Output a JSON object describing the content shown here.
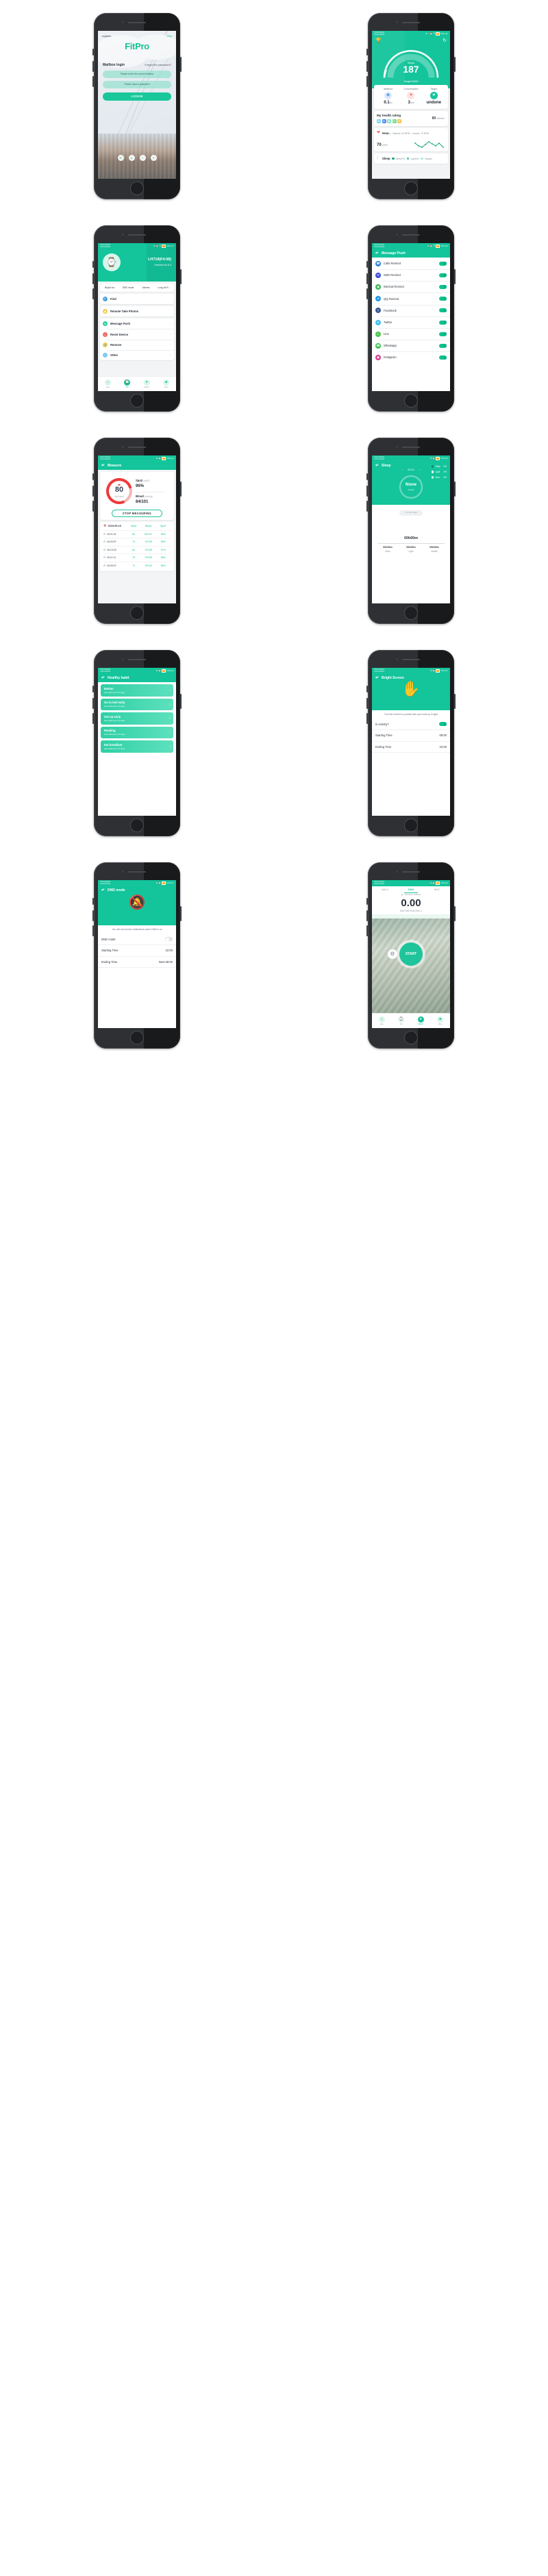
{
  "brand": "FitPro",
  "colors": {
    "primary": "#14c49b",
    "accent": "#19c79a",
    "heart": "#ef4b4b"
  },
  "statusbar": {
    "carrier1": "China Mobile",
    "carrier2": "China Mobile",
    "battery": "22",
    "time_dashboard": "5:01 pm",
    "time_device": "3:52 pm",
    "time_measure": "4:08 pm",
    "time_sleep": "4:18 pm",
    "time_habit": "4:18 pm",
    "time_bright": "4:18 pm",
    "time_dnd": "4:18 pm",
    "time_sport": "4:18 pm"
  },
  "login": {
    "register": "register",
    "skip": "Skip",
    "mailbox_login": "Mailbox login",
    "forget": "Forget the password?",
    "email_placeholder": "Please enter the correct mailbox",
    "password_placeholder": "Please input a password",
    "login_button": "LOGIN",
    "social_icons": [
      "wechat-icon",
      "qq-icon",
      "facebook-icon",
      "twitter-icon"
    ]
  },
  "dashboard": {
    "trophy_icon": "trophy-icon",
    "sync_icon": "sync-icon",
    "steps_label": "Steps",
    "steps_value": "187",
    "target_text": "Target:5000",
    "steps_percent": 4,
    "stats": [
      {
        "label": "distance",
        "value": "0.1",
        "unit": "km",
        "icon": "location-icon",
        "color": "#4a90e2"
      },
      {
        "label": "Consumption",
        "value": "3",
        "unit": "kcal",
        "icon": "flame-icon",
        "color": "#f2635f"
      },
      {
        "label": "Target",
        "value": "undone",
        "unit": "",
        "icon": "star-icon",
        "color": "#17c49b"
      }
    ],
    "health_rating_title": "My health rating",
    "grades": [
      {
        "letter": "S",
        "color": "#7fd8f0"
      },
      {
        "letter": "A",
        "color": "#5a8de8"
      },
      {
        "letter": "B",
        "color": "#8fe3bf"
      },
      {
        "letter": "C",
        "color": "#7bdd93"
      },
      {
        "letter": "F",
        "color": "#f7c45a"
      }
    ],
    "rating_value": "89",
    "rating_unit": "Minute",
    "heart_title": "Hear..",
    "heart_highest": "Highest: 84 BPM",
    "heart_lowest": "Lowest: 70 BPM",
    "heart_value": "70",
    "heart_unit": "BPM",
    "heart_series": [
      8,
      13,
      6,
      12,
      15,
      9,
      13,
      10,
      4
    ],
    "sleep_title": "Sleep",
    "sleep_legend": [
      {
        "label": "Deep0%",
        "color": "#0fa688"
      },
      {
        "label": "Light0%",
        "color": "#2fc9a5"
      },
      {
        "label": "Awake..",
        "color": "#9ef0d8"
      }
    ]
  },
  "device": {
    "name": "LH719(F4:08)",
    "version": "Version:V4.6.3",
    "watch_icon": "watch-icon",
    "quad": [
      "Bright scr..",
      "DND mode",
      "Alarms",
      "Long sit R.."
    ],
    "items": [
      {
        "label": "Find",
        "icon": "search-icon",
        "color": "#4aa8e8",
        "chev": false
      },
      {
        "label": "Remote Take Photos",
        "icon": "camera-icon",
        "color": "#f2cd4a",
        "chev": false
      },
      {
        "label": "Message Push",
        "icon": "send-icon",
        "color": "#2ecfa4",
        "chev": true
      },
      {
        "label": "Reset Device",
        "icon": "undo-icon",
        "color": "#f2706b",
        "chev": true
      },
      {
        "label": "Remove",
        "icon": "link-icon",
        "color": "#f2cd4a",
        "chev": true
      },
      {
        "label": "Other",
        "icon": "more-icon",
        "color": "#7ec8f0",
        "chev": true
      }
    ]
  },
  "tabbar": {
    "items": [
      {
        "label": "step",
        "icon": "home-icon"
      },
      {
        "label": "Set",
        "icon": "watch-icon"
      },
      {
        "label": "Motion",
        "icon": "run-icon"
      },
      {
        "label": "Mine",
        "icon": "user-icon"
      }
    ],
    "active_index": 1,
    "sport_active_index": 2
  },
  "message_push": {
    "title": "Message Push",
    "back_icon": "back-icon",
    "items": [
      {
        "label": "Calls Remind",
        "icon": "phone-icon",
        "color": "#2b7fd4",
        "on": true
      },
      {
        "label": "SMS Remind",
        "icon": "envelope-icon",
        "color": "#3b4fd8",
        "on": true
      },
      {
        "label": "Wechat Remind",
        "icon": "wechat-icon",
        "color": "#41b858",
        "on": true
      },
      {
        "label": "QQ Remind",
        "icon": "qq-icon",
        "color": "#1f9ae8",
        "on": true
      },
      {
        "label": "FaceBook",
        "icon": "facebook-icon",
        "color": "#3b5998",
        "on": true
      },
      {
        "label": "Twitter",
        "icon": "twitter-icon",
        "color": "#40c4f5",
        "on": true
      },
      {
        "label": "Line",
        "icon": "line-icon",
        "color": "#4ac94a",
        "on": true
      },
      {
        "label": "Whatsapp",
        "icon": "whatsapp-icon",
        "color": "#34c14f",
        "on": true
      },
      {
        "label": "Instagram",
        "icon": "instagram-icon",
        "color": "#d63b8a",
        "on": true
      }
    ]
  },
  "measure": {
    "title": "Measure",
    "back_icon": "back-icon",
    "heart_value": "80",
    "heart_unit": "unit: bpm",
    "spo2_label": "Spo2",
    "spo2_unit": "(sp02)",
    "spo2_value": "96%",
    "blood_label": "Blood",
    "blood_unit": "(mmHg)",
    "blood_value": "84/101",
    "stop_button": "STOP MEASURING",
    "calendar_icon": "calendar-icon",
    "date": "2019-09-10",
    "columns": [
      "Heart",
      "Blood",
      "Spo2"
    ],
    "rows": [
      {
        "time": "16:21:41",
        "heart": "80",
        "blood": "84/101",
        "spo2": "96%"
      },
      {
        "time": "16:20:57",
        "heart": "74",
        "blood": "70/105",
        "spo2": "95%"
      },
      {
        "time": "16:19:33",
        "heart": "84",
        "blood": "72/125",
        "spo2": "97%"
      },
      {
        "time": "16:11:11",
        "heart": "78",
        "blood": "74/105",
        "spo2": "96%"
      },
      {
        "time": "16:09:37",
        "heart": "72",
        "blood": "76/119",
        "spo2": "96%"
      }
    ]
  },
  "sleep": {
    "title": "Sleep",
    "back_icon": "back-icon",
    "date": "09-10",
    "prev_icon": "chevron-left-icon",
    "next_icon": "chevron-right-icon",
    "main_value": "None",
    "main_sub": "Quality",
    "legend": [
      {
        "label": "Deep",
        "value": "0%",
        "color": "#0c8f76"
      },
      {
        "label": "Light",
        "value": "0%",
        "color": "#ffffff"
      },
      {
        "label": "Awa..",
        "value": "0%",
        "color": "#bdf3e3"
      }
    ],
    "no_data": "no more data",
    "total": "00h00m",
    "columns": [
      {
        "value": "00h00m",
        "label": "Deep"
      },
      {
        "value": "00h00m",
        "label": "Light"
      },
      {
        "value": "00h00m",
        "label": "Awake"
      }
    ]
  },
  "habits": {
    "title": "Healthy habit",
    "back_icon": "back-icon",
    "items": [
      {
        "title": "Motion",
        "sub": "Has adhered to 0 days"
      },
      {
        "title": "Go to bed early",
        "sub": "Has adhered to 0 days"
      },
      {
        "title": "Get up early",
        "sub": "Has adhered to 0 days"
      },
      {
        "title": "Reading",
        "sub": "Has adhered to 0 days"
      },
      {
        "title": "Eat breakfast",
        "sub": "Has adhered to 0 days"
      }
    ]
  },
  "bright_screen": {
    "title": "Bright Screen",
    "back_icon": "back-icon",
    "hand_icon": "wrist-raise-icon",
    "note": "Turn the screen to yourself with your wrist up to light",
    "rows": [
      {
        "label": "Is Activity?",
        "value": "",
        "toggle": true,
        "on": true
      },
      {
        "label": "Starting Time",
        "value": "08:00",
        "toggle": false
      },
      {
        "label": "Ending Time",
        "value": "22:00",
        "toggle": false
      }
    ]
  },
  "dnd": {
    "title": "DND mode",
    "back_icon": "back-icon",
    "bell_icon": "bell-off-icon",
    "note": "You will not receive notifications when DND is on",
    "rows": [
      {
        "label": "DND mode",
        "value": "",
        "toggle": true,
        "on": false
      },
      {
        "label": "Starting Time",
        "value": "22:00",
        "toggle": false
      },
      {
        "label": "Ending Time",
        "value": "Next 08:00",
        "toggle": false
      }
    ]
  },
  "sport": {
    "tabs": [
      "WALK",
      "RUN",
      "BIKE"
    ],
    "active_tab": 1,
    "weather_icon": "cloud-icon",
    "weather_text": "Unknown weather",
    "distance": "0.00",
    "unit": "Bike/Total kilometers 3",
    "start_button": "START",
    "gear_icon": "gear-icon"
  }
}
